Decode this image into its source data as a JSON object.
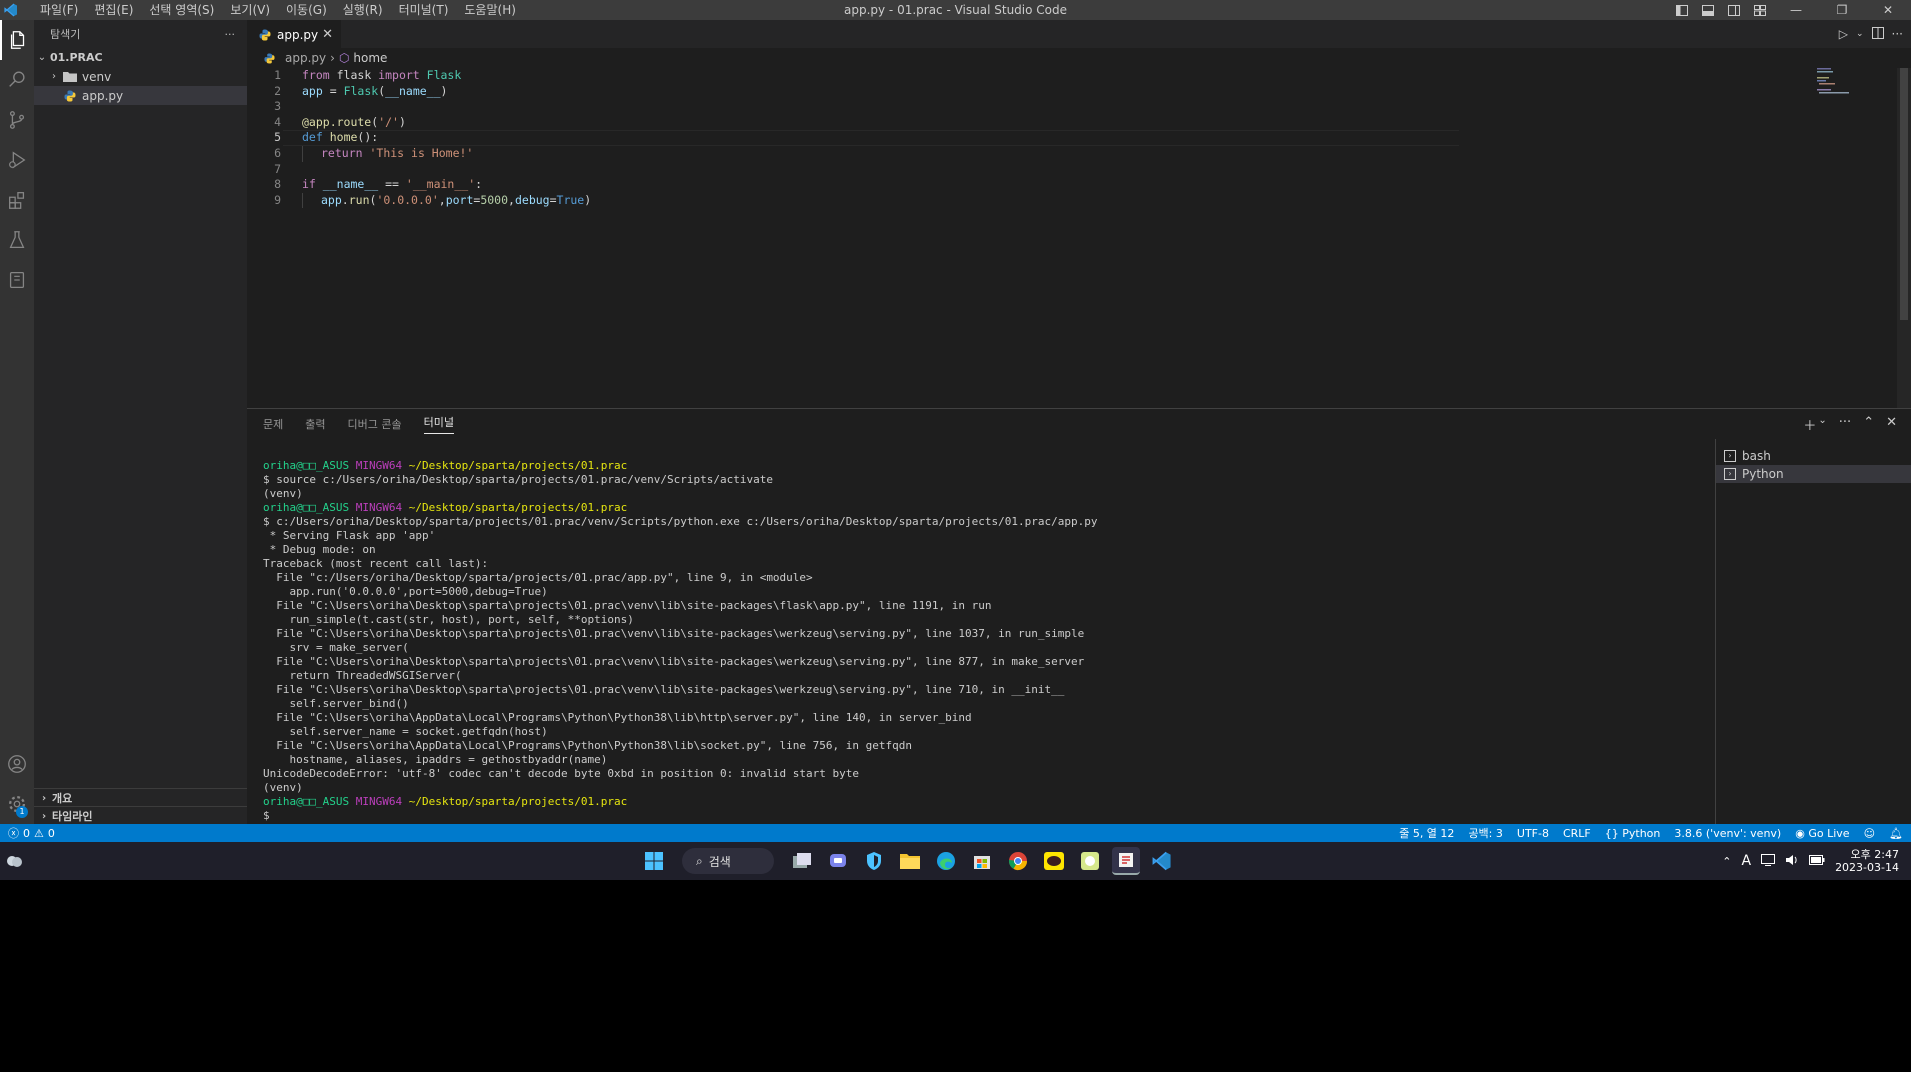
{
  "window": {
    "title": "app.py - 01.prac - Visual Studio Code",
    "menu": [
      "파일(F)",
      "편집(E)",
      "선택 영역(S)",
      "보기(V)",
      "이동(G)",
      "실행(R)",
      "터미널(T)",
      "도움말(H)"
    ]
  },
  "sidebar": {
    "header": "탐색기",
    "more": "···",
    "root_folder": "01.PRAC",
    "items": [
      {
        "label": "venv",
        "type": "folder"
      },
      {
        "label": "app.py",
        "type": "python-file"
      }
    ],
    "sections": [
      "개요",
      "타임라인"
    ]
  },
  "editor": {
    "tab_label": "app.py",
    "tab_close": "✕",
    "breadcrumb": {
      "file": "app.py",
      "symbol": "home"
    },
    "line_numbers": [
      "1",
      "2",
      "3",
      "4",
      "5",
      "6",
      "7",
      "8",
      "9"
    ],
    "active_line": 5,
    "code": {
      "l1": {
        "a": "from",
        "b": " flask ",
        "c": "import",
        "d": " Flask"
      },
      "l2": {
        "a": "app",
        "b": " = ",
        "c": "Flask",
        "d": "(",
        "e": "__name__",
        "f": ")"
      },
      "l4": {
        "a": "@app.route",
        "b": "(",
        "c": "'/'",
        "d": ")"
      },
      "l5": {
        "a": "def",
        "b": " ",
        "c": "home",
        "d": "():"
      },
      "l6": {
        "a": "return",
        "b": " ",
        "c": "'This is Home!'"
      },
      "l8": {
        "a": "if",
        "b": " ",
        "c": "__name__",
        "d": " == ",
        "e": "'__main__'",
        "f": ":"
      },
      "l9": {
        "a": "app",
        "b": ".",
        "c": "run",
        "d": "(",
        "e": "'0.0.0.0'",
        "f": ",",
        "g": "port",
        "h": "=",
        "i": "5000",
        "j": ",",
        "k": "debug",
        "l": "=",
        "m": "True",
        "n": ")"
      }
    }
  },
  "panel": {
    "tabs": [
      "문제",
      "출력",
      "디버그 콘솔",
      "터미널"
    ],
    "active_tab": "터미널",
    "terminal_lines": [
      {
        "kind": "prompt",
        "user": "oriha@□□_ASUS",
        "shell": "MINGW64",
        "path": "~/Desktop/sparta/projects/01.prac"
      },
      {
        "kind": "text",
        "text": "$ source c:/Users/oriha/Desktop/sparta/projects/01.prac/venv/Scripts/activate"
      },
      {
        "kind": "text",
        "text": "(venv)"
      },
      {
        "kind": "prompt",
        "user": "oriha@□□_ASUS",
        "shell": "MINGW64",
        "path": "~/Desktop/sparta/projects/01.prac"
      },
      {
        "kind": "text",
        "text": "$ c:/Users/oriha/Desktop/sparta/projects/01.prac/venv/Scripts/python.exe c:/Users/oriha/Desktop/sparta/projects/01.prac/app.py"
      },
      {
        "kind": "text",
        "text": " * Serving Flask app 'app'"
      },
      {
        "kind": "text",
        "text": " * Debug mode: on"
      },
      {
        "kind": "text",
        "text": "Traceback (most recent call last):"
      },
      {
        "kind": "text",
        "text": "  File \"c:/Users/oriha/Desktop/sparta/projects/01.prac/app.py\", line 9, in <module>"
      },
      {
        "kind": "text",
        "text": "    app.run('0.0.0.0',port=5000,debug=True)"
      },
      {
        "kind": "text",
        "text": "  File \"C:\\Users\\oriha\\Desktop\\sparta\\projects\\01.prac\\venv\\lib\\site-packages\\flask\\app.py\", line 1191, in run"
      },
      {
        "kind": "text",
        "text": "    run_simple(t.cast(str, host), port, self, **options)"
      },
      {
        "kind": "text",
        "text": "  File \"C:\\Users\\oriha\\Desktop\\sparta\\projects\\01.prac\\venv\\lib\\site-packages\\werkzeug\\serving.py\", line 1037, in run_simple"
      },
      {
        "kind": "text",
        "text": "    srv = make_server("
      },
      {
        "kind": "text",
        "text": "  File \"C:\\Users\\oriha\\Desktop\\sparta\\projects\\01.prac\\venv\\lib\\site-packages\\werkzeug\\serving.py\", line 877, in make_server"
      },
      {
        "kind": "text",
        "text": "    return ThreadedWSGIServer("
      },
      {
        "kind": "text",
        "text": "  File \"C:\\Users\\oriha\\Desktop\\sparta\\projects\\01.prac\\venv\\lib\\site-packages\\werkzeug\\serving.py\", line 710, in __init__"
      },
      {
        "kind": "text",
        "text": "    self.server_bind()"
      },
      {
        "kind": "text",
        "text": "  File \"C:\\Users\\oriha\\AppData\\Local\\Programs\\Python\\Python38\\lib\\http\\server.py\", line 140, in server_bind"
      },
      {
        "kind": "text",
        "text": "    self.server_name = socket.getfqdn(host)"
      },
      {
        "kind": "text",
        "text": "  File \"C:\\Users\\oriha\\AppData\\Local\\Programs\\Python\\Python38\\lib\\socket.py\", line 756, in getfqdn"
      },
      {
        "kind": "text",
        "text": "    hostname, aliases, ipaddrs = gethostbyaddr(name)"
      },
      {
        "kind": "text",
        "text": "UnicodeDecodeError: 'utf-8' codec can't decode byte 0xbd in position 0: invalid start byte"
      },
      {
        "kind": "text",
        "text": "(venv)"
      },
      {
        "kind": "prompt",
        "user": "oriha@□□_ASUS",
        "shell": "MINGW64",
        "path": "~/Desktop/sparta/projects/01.prac"
      },
      {
        "kind": "text",
        "text": "$"
      }
    ],
    "terminals": [
      "bash",
      "Python"
    ],
    "selected_terminal": "Python"
  },
  "statusbar": {
    "errors": "0",
    "warnings": "0",
    "position": "줄 5, 열 12",
    "spaces": "공백: 3",
    "encoding": "UTF-8",
    "eol": "CRLF",
    "language": "Python",
    "interpreter": "3.8.6 ('venv': venv)",
    "golive": "Go Live"
  },
  "taskbar": {
    "search_label": "검색",
    "clock_ampm_time": "오후 2:47",
    "clock_date": "2023-03-14",
    "ime": "A",
    "notification_count": "1"
  },
  "colors": {
    "accent": "#007acc",
    "titlebar": "#3c3c3c",
    "sidebar": "#252526",
    "editor_bg": "#1e1e1e",
    "prompt_user": "#23d18b",
    "prompt_shell": "#bc3fbc",
    "prompt_path": "#e5e510"
  }
}
